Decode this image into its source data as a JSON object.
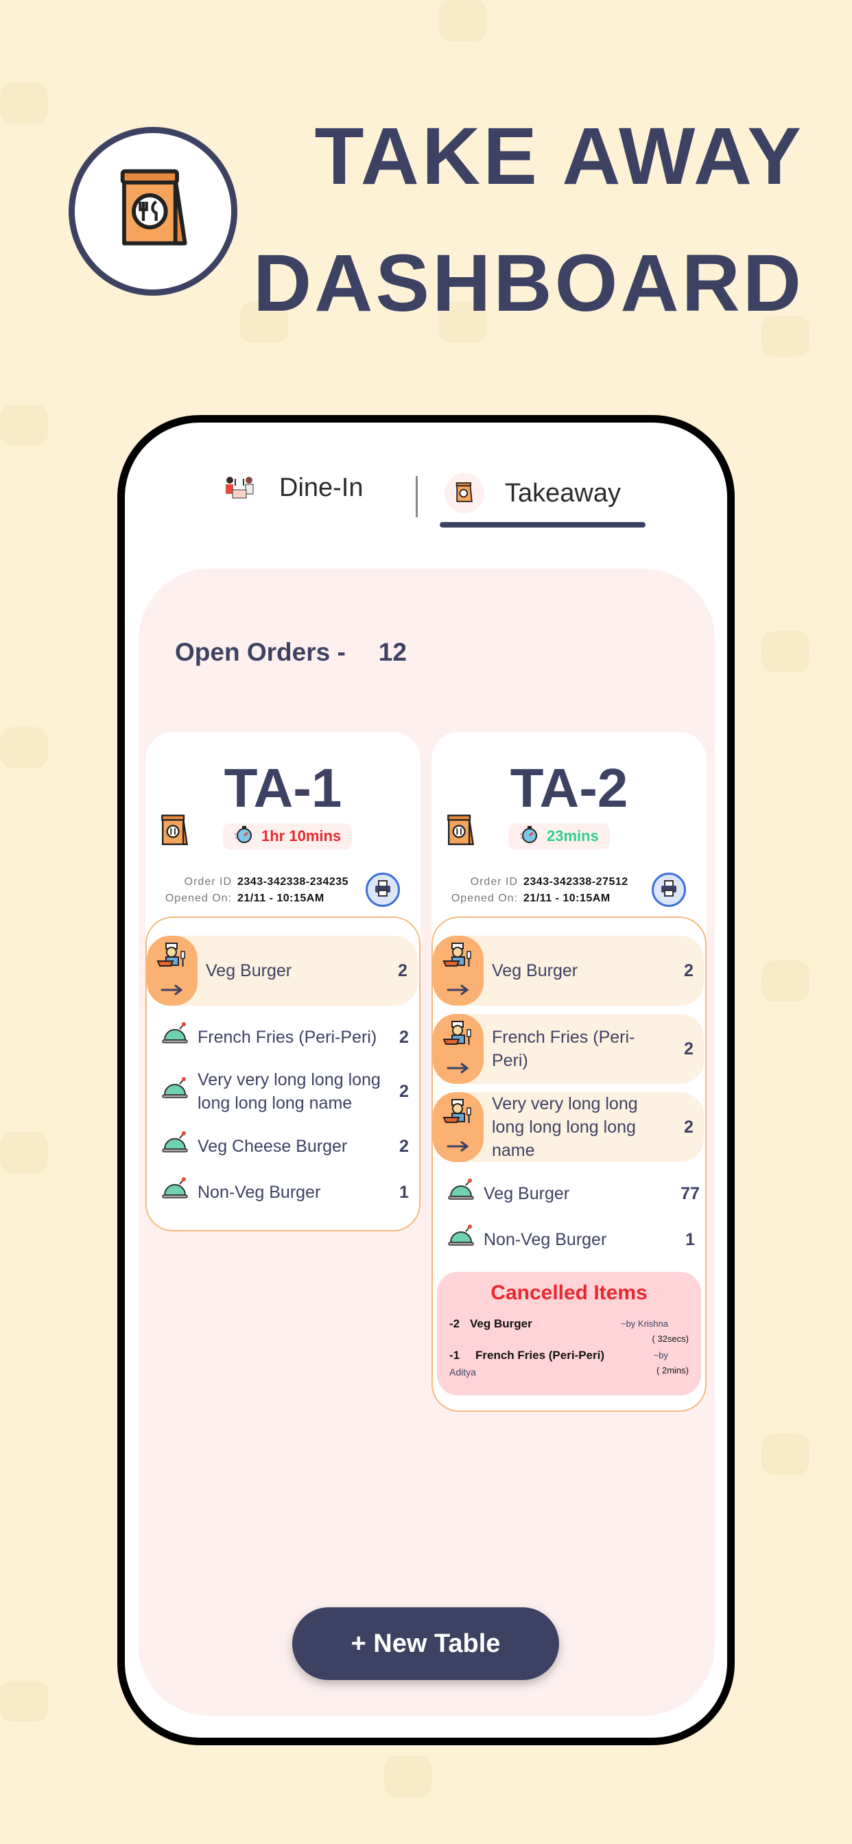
{
  "hero": {
    "line1": "TAKE AWAY",
    "line2": "DASHBOARD"
  },
  "tabs": [
    {
      "label": "Dine-In",
      "icon": "dine-in-icon",
      "active": false
    },
    {
      "label": "Takeaway",
      "icon": "takeaway-bag-icon",
      "active": true
    }
  ],
  "open_orders": {
    "label": "Open Orders -",
    "count": "12"
  },
  "colors": {
    "primary": "#3d4263",
    "accent": "#fbb172",
    "danger": "#e8282f",
    "success": "#2fcf8c",
    "background": "#fdf2d6"
  },
  "orders": [
    {
      "title": "TA-1",
      "timer": "1hr 10mins",
      "timer_color": "#e8282f",
      "order_id_label": "Order ID",
      "order_id": "2343-342338-234235",
      "opened_label": "Opened On:",
      "opened": "21/11 - 10:15AM",
      "items": [
        {
          "name": "Veg Burger",
          "qty": "2",
          "status": "preparing"
        },
        {
          "name": "French Fries (Peri-Peri)",
          "qty": "2",
          "status": "served"
        },
        {
          "name": "Very very long long long long long long name",
          "qty": "2",
          "status": "served"
        },
        {
          "name": "Veg Cheese Burger",
          "qty": "2",
          "status": "served"
        },
        {
          "name": "Non-Veg Burger",
          "qty": "1",
          "status": "served"
        }
      ]
    },
    {
      "title": "TA-2",
      "timer": "23mins",
      "timer_color": "#2fcf8c",
      "order_id_label": "Order ID",
      "order_id": "2343-342338-27512",
      "opened_label": "Opened On:",
      "opened": "21/11 - 10:15AM",
      "items": [
        {
          "name": "Veg Burger",
          "qty": "2",
          "status": "preparing"
        },
        {
          "name": "French Fries (Peri-Peri)",
          "qty": "2",
          "status": "preparing"
        },
        {
          "name": "Very very long long long long long long name",
          "qty": "2",
          "status": "preparing"
        },
        {
          "name": "Veg Burger",
          "qty": "77",
          "status": "served"
        },
        {
          "name": "Non-Veg Burger",
          "qty": "1",
          "status": "served"
        }
      ],
      "cancelled": {
        "title": "Cancelled Items",
        "items": [
          {
            "qty": "-2",
            "name": "Veg Burger",
            "by": "~by Krishna",
            "ago": "( 32secs)"
          },
          {
            "qty": "-1",
            "name": "French Fries (Peri-Peri)",
            "by": "~by",
            "who": "Aditya",
            "ago": "( 2mins)"
          }
        ]
      }
    }
  ],
  "new_table_button": "+ New Table"
}
